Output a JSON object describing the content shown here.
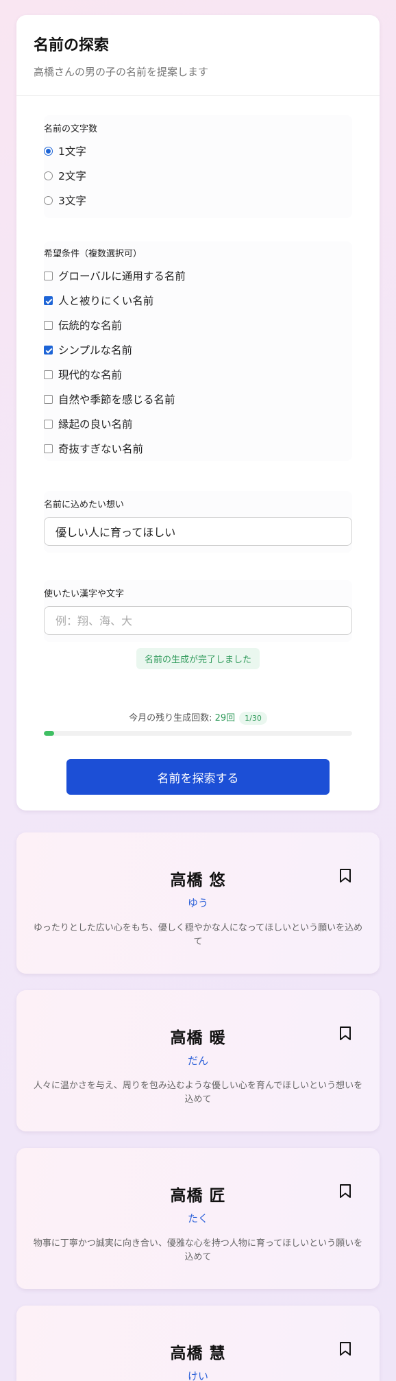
{
  "header": {
    "title": "名前の探索",
    "subtitle": "高橋さんの男の子の名前を提案します"
  },
  "char_count": {
    "label": "名前の文字数",
    "options": [
      {
        "label": "1文字",
        "selected": true
      },
      {
        "label": "2文字",
        "selected": false
      },
      {
        "label": "3文字",
        "selected": false
      }
    ]
  },
  "conditions": {
    "label": "希望条件（複数選択可）",
    "options": [
      {
        "label": "グローバルに通用する名前",
        "checked": false
      },
      {
        "label": "人と被りにくい名前",
        "checked": true
      },
      {
        "label": "伝統的な名前",
        "checked": false
      },
      {
        "label": "シンプルな名前",
        "checked": true
      },
      {
        "label": "現代的な名前",
        "checked": false
      },
      {
        "label": "自然や季節を感じる名前",
        "checked": false
      },
      {
        "label": "縁起の良い名前",
        "checked": false
      },
      {
        "label": "奇抜すぎない名前",
        "checked": false
      }
    ]
  },
  "wish": {
    "label": "名前に込めたい想い",
    "value": "優しい人に育ってほしい"
  },
  "kanji": {
    "label": "使いたい漢字や文字",
    "placeholder": "例：翔、海、大",
    "value": ""
  },
  "status": {
    "message": "名前の生成が完了しました"
  },
  "remaining": {
    "prefix": "今月の残り生成回数: ",
    "count": "29回",
    "pill": "1/30",
    "used_fraction": 0.033
  },
  "search_button": {
    "label": "名前を探索する"
  },
  "colors": {
    "accent": "#1c4fd6",
    "success": "#2f9a5a",
    "progress": "#3fbf63"
  },
  "results": [
    {
      "name": "高橋 悠",
      "reading": "ゆう",
      "description": "ゆったりとした広い心をもち、優しく穏やかな人になってほしいという願いを込めて",
      "icon": "bookmark-icon"
    },
    {
      "name": "高橋 暖",
      "reading": "だん",
      "description": "人々に温かさを与え、周りを包み込むような優しい心を育んでほしいという想いを込めて",
      "icon": "bookmark-icon"
    },
    {
      "name": "高橋 匠",
      "reading": "たく",
      "description": "物事に丁寧かつ誠実に向き合い、優雅な心を持つ人物に育ってほしいという願いを込めて",
      "icon": "bookmark-icon"
    },
    {
      "name": "高橋 慧",
      "reading": "けい",
      "description": "",
      "icon": "bookmark-icon"
    }
  ]
}
